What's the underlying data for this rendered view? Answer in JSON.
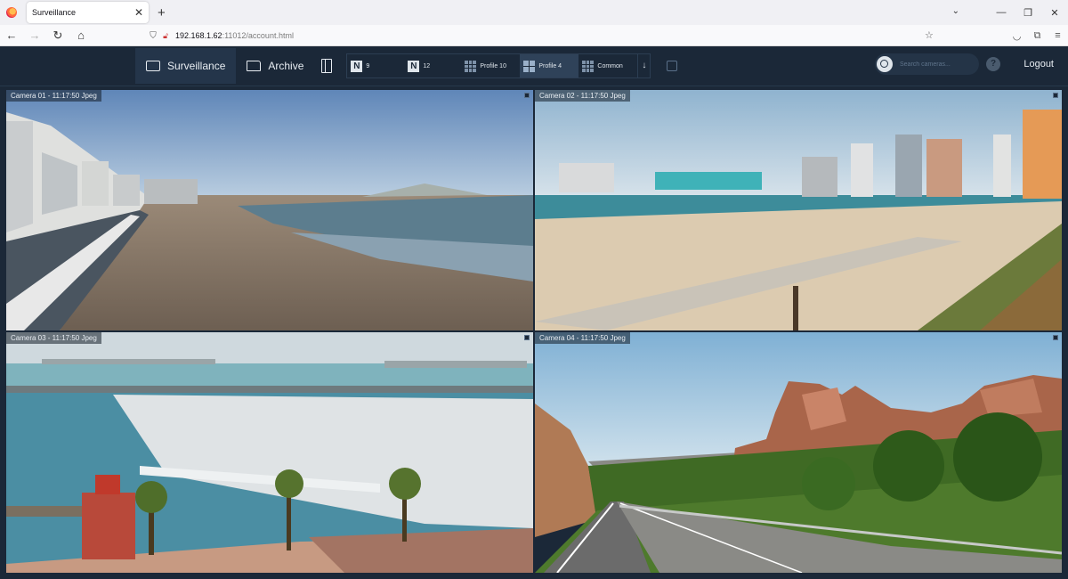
{
  "browser": {
    "tab_title": "Surveillance",
    "tab_close": "✕",
    "new_tab": "+",
    "url_host": "192.168.1.62",
    "url_path": ":11012/account.html",
    "icons": [
      "back-icon",
      "forward-icon",
      "reload-icon",
      "home-icon",
      "shield-icon",
      "lock-icon",
      "bookmark-star-icon",
      "pocket-icon",
      "extensions-icon",
      "menu-icon"
    ]
  },
  "app": {
    "modes": [
      {
        "label": "Surveillance",
        "active": true
      },
      {
        "label": "Archive",
        "active": false
      }
    ],
    "profiles": [
      {
        "label": "9",
        "icon": "N",
        "active": false
      },
      {
        "label": "12",
        "icon": "N",
        "active": false
      },
      {
        "label": "Profile 10",
        "icon": "grid",
        "active": false
      },
      {
        "label": "Profile 4",
        "icon": "grid",
        "active": true
      },
      {
        "label": "Common",
        "icon": "grid",
        "active": false
      }
    ],
    "download_glyph": "↓",
    "search_placeholder": "Search cameras...",
    "help_glyph": "?",
    "logout_label": "Logout"
  },
  "cameras": [
    {
      "label": "Camera 01 - 11:17:50 Jpeg",
      "scene": "beach-promenade"
    },
    {
      "label": "Camera 02 - 11:17:50 Jpeg",
      "scene": "city-beach"
    },
    {
      "label": "Camera 03 - 11:17:50 Jpeg",
      "scene": "marina"
    },
    {
      "label": "Camera 04 - 11:17:50 Jpeg",
      "scene": "mountain-road"
    }
  ]
}
